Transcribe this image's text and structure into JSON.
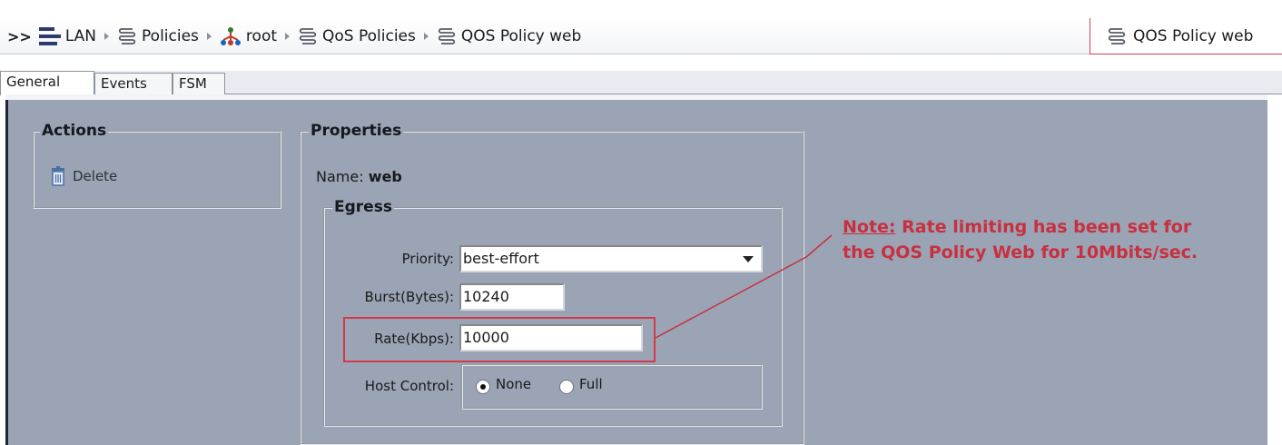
{
  "breadcrumb": {
    "expand": ">>",
    "items": [
      {
        "label": "LAN",
        "icon": "lan-icon"
      },
      {
        "label": "Policies",
        "icon": "policy-icon"
      },
      {
        "label": "root",
        "icon": "org-tree-icon"
      },
      {
        "label": "QoS Policies",
        "icon": "policy-icon"
      },
      {
        "label": "QOS Policy web",
        "icon": "policy-icon"
      }
    ]
  },
  "open_tab": {
    "label": "QOS Policy web",
    "icon": "policy-icon"
  },
  "tabs": [
    "General",
    "Events",
    "FSM"
  ],
  "actions": {
    "title": "Actions",
    "delete_label": "Delete"
  },
  "properties": {
    "title": "Properties",
    "name_label": "Name:",
    "name_value": "web",
    "egress": {
      "title": "Egress",
      "priority_label": "Priority:",
      "priority_value": "best-effort",
      "burst_label": "Burst(Bytes):",
      "burst_value": "10240",
      "rate_label": "Rate(Kbps):",
      "rate_value": "10000",
      "host_control_label": "Host Control:",
      "host_control_options": [
        "None",
        "Full"
      ],
      "host_control_selected": "None"
    }
  },
  "note": {
    "heading": "Note:",
    "line1": "Rate limiting has been set for",
    "line2": "the QOS Policy Web for 10Mbits/sec."
  },
  "colors": {
    "annotation": "#c8303f",
    "panel": "#9aa4b4"
  }
}
